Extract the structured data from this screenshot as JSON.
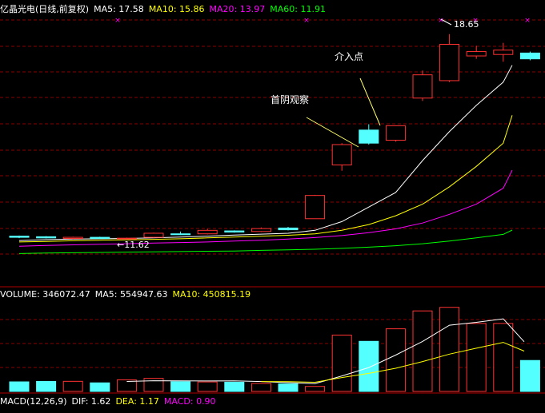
{
  "colors": {
    "background": "#000000",
    "up": "#ff3232",
    "down": "#54ffff",
    "ma5": "#ffffff",
    "ma10": "#ffff00",
    "ma20": "#ff00ff",
    "ma60": "#00ff00",
    "grid": "#8b0000",
    "text": "#ffffff"
  },
  "header": {
    "title": "亿晶光电(日线,前复权)",
    "ma5": "MA5: 17.58",
    "ma10": "MA10: 15.86",
    "ma20": "MA20: 13.97",
    "ma60": "MA60: 11.91"
  },
  "volume_header": {
    "volume": "VOLUME: 346072.47",
    "ma5": "MA5: 554947.63",
    "ma10": "MA10: 450815.19"
  },
  "macd_header": {
    "name": "MACD(12,26,9)",
    "dif": "DIF: 1.62",
    "dea": "DEA: 1.17",
    "macd": "MACD: 0.90"
  },
  "annotations": {
    "first_yin": "首阴观察",
    "entry": "介入点",
    "high_label": "18.65",
    "low_label": "11.62"
  },
  "chart_data": {
    "type": "candlestick",
    "title": "亿晶光电(日线,前复权)",
    "price_high": 18.65,
    "price_low": 11.62,
    "candles": [
      {
        "o": 11.7,
        "c": 11.66,
        "h": 11.72,
        "l": 11.63
      },
      {
        "o": 11.68,
        "c": 11.64,
        "h": 11.7,
        "l": 11.62
      },
      {
        "o": 11.62,
        "c": 11.66,
        "h": 11.68,
        "l": 11.6
      },
      {
        "o": 11.66,
        "c": 11.62,
        "h": 11.68,
        "l": 11.6
      },
      {
        "o": 11.62,
        "c": 11.63,
        "h": 11.65,
        "l": 11.58
      },
      {
        "o": 11.66,
        "c": 11.8,
        "h": 11.82,
        "l": 11.64
      },
      {
        "o": 11.78,
        "c": 11.75,
        "h": 11.86,
        "l": 11.74
      },
      {
        "o": 11.78,
        "c": 11.9,
        "h": 11.95,
        "l": 11.76
      },
      {
        "o": 11.88,
        "c": 11.84,
        "h": 11.9,
        "l": 11.82
      },
      {
        "o": 11.86,
        "c": 11.96,
        "h": 12.0,
        "l": 11.84
      },
      {
        "o": 11.98,
        "c": 11.92,
        "h": 12.02,
        "l": 11.9
      },
      {
        "o": 12.3,
        "c": 13.1,
        "h": 13.12,
        "l": 12.3
      },
      {
        "o": 14.15,
        "c": 14.85,
        "h": 14.9,
        "l": 13.95
      },
      {
        "o": 15.35,
        "c": 14.9,
        "h": 15.55,
        "l": 14.85
      },
      {
        "o": 15.0,
        "c": 15.5,
        "h": 15.5,
        "l": 14.95
      },
      {
        "o": 16.45,
        "c": 17.25,
        "h": 17.4,
        "l": 16.35
      },
      {
        "o": 17.05,
        "c": 18.3,
        "h": 18.65,
        "l": 17.0
      },
      {
        "o": 17.9,
        "c": 18.05,
        "h": 18.25,
        "l": 17.8
      },
      {
        "o": 17.95,
        "c": 18.1,
        "h": 18.35,
        "l": 17.7
      },
      {
        "o": 18.0,
        "c": 17.8,
        "h": 18.05,
        "l": 17.75
      }
    ],
    "ma5": [
      11.55,
      11.58,
      11.6,
      11.61,
      11.62,
      11.64,
      11.67,
      11.7,
      11.74,
      11.77,
      11.8,
      11.9,
      12.2,
      12.7,
      13.2,
      14.3,
      15.3,
      16.2,
      17.0,
      17.58
    ],
    "ma10": [
      11.5,
      11.52,
      11.54,
      11.56,
      11.57,
      11.59,
      11.61,
      11.64,
      11.67,
      11.7,
      11.73,
      11.78,
      11.9,
      12.1,
      12.4,
      12.8,
      13.4,
      14.1,
      14.9,
      15.86
    ],
    "ma20": [
      11.35,
      11.38,
      11.4,
      11.42,
      11.44,
      11.46,
      11.48,
      11.5,
      11.53,
      11.56,
      11.6,
      11.65,
      11.72,
      11.82,
      11.95,
      12.15,
      12.45,
      12.8,
      13.35,
      13.97
    ],
    "ma60": [
      11.1,
      11.12,
      11.13,
      11.14,
      11.15,
      11.16,
      11.17,
      11.18,
      11.19,
      11.21,
      11.23,
      11.25,
      11.28,
      11.32,
      11.37,
      11.44,
      11.53,
      11.64,
      11.76,
      11.91
    ],
    "volume": {
      "values": [
        107000,
        112000,
        113000,
        96000,
        129000,
        146000,
        109000,
        106000,
        103000,
        89000,
        84000,
        56000,
        630000,
        560000,
        700000,
        900000,
        940000,
        760000,
        760000,
        346072
      ],
      "ma5": [
        null,
        null,
        null,
        null,
        111400,
        119200,
        118600,
        116800,
        118600,
        110600,
        98200,
        87600,
        173600,
        267000,
        406000,
        559000,
        740000,
        772000,
        812000,
        554948
      ],
      "ma10": [
        null,
        null,
        null,
        null,
        null,
        null,
        null,
        null,
        null,
        111000,
        108700,
        103100,
        155300,
        201700,
        258800,
        334200,
        417300,
        482700,
        548400,
        450815
      ]
    }
  }
}
